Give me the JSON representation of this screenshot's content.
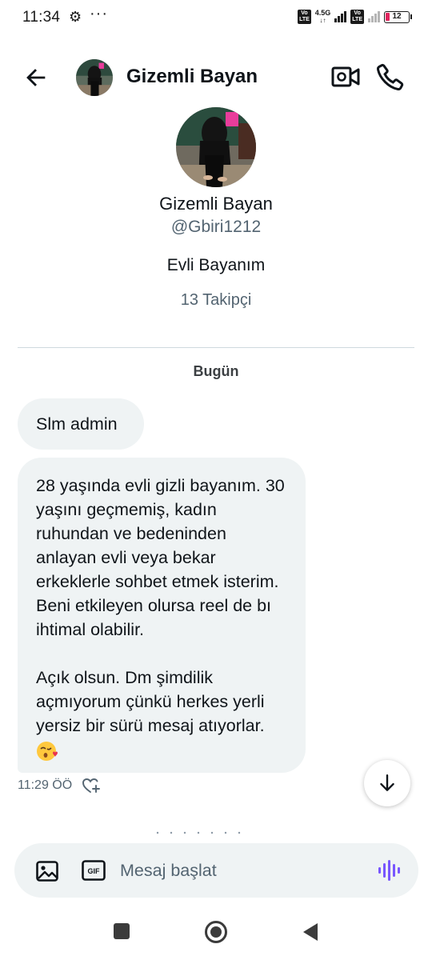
{
  "status_bar": {
    "time": "11:34",
    "network": "4.5G",
    "volte_label": "Vo LTE",
    "battery": "12"
  },
  "header": {
    "name": "Gizemli Bayan"
  },
  "profile": {
    "name": "Gizemli Bayan",
    "handle": "@Gbiri1212",
    "bio": "Evli Bayanım",
    "followers": "13 Takipçi"
  },
  "conversation": {
    "date_label": "Bugün",
    "messages": [
      {
        "text": "Slm admin"
      },
      {
        "paragraph_1": "28 yaşında evli gizli bayanım. 30 yaşını geçmemiş, kadın ruhundan ve bedeninden anlayan evli veya bekar erkeklerle sohbet etmek isterim. Beni etkileyen olursa reel de bı ihtimal olabilir.",
        "paragraph_2": "Açık olsun. Dm şimdilik açmıyorum çünkü herkes yerli yersiz bir sürü mesaj atıyorlar.",
        "emoji": "kissing-heart-emoji"
      }
    ],
    "timestamp": "11:29 ÖÖ"
  },
  "composer": {
    "placeholder": "Mesaj başlat",
    "gif_label": "GIF"
  },
  "colors": {
    "bubble": "#eff3f4",
    "secondary_text": "#536471",
    "voice_accent": "#7856ff",
    "battery_low": "#e0245e"
  }
}
